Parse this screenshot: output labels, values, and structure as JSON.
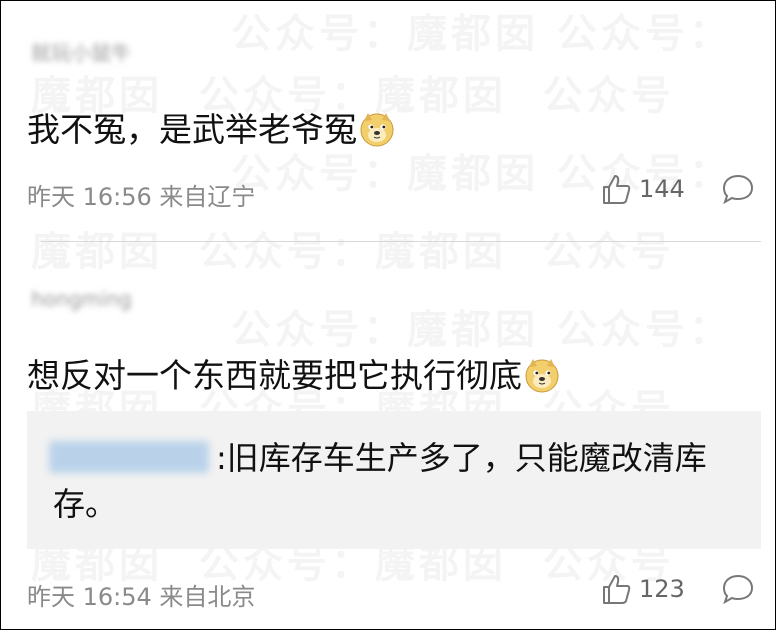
{
  "comments": [
    {
      "username": "就玩小鼠牛",
      "text": "我不冤，是武举老爷冤",
      "emoji": "doge-emoji",
      "time": "昨天 16:56 来自辽宁",
      "likes": "144"
    },
    {
      "username": "hongming",
      "text": "想反对一个东西就要把它执行彻底",
      "emoji": "doge-emoji",
      "time": "昨天 16:54 来自北京",
      "likes": "123",
      "quoted_reply": {
        "user": "",
        "text": ":旧库存车生产多了，只能魔改清库存。"
      }
    }
  ],
  "watermark": "魔都囡 公众号",
  "colors": {
    "meta_text": "#8a8a8a",
    "quote_bg": "#f2f2f2",
    "doge": "#f3cf6c"
  }
}
